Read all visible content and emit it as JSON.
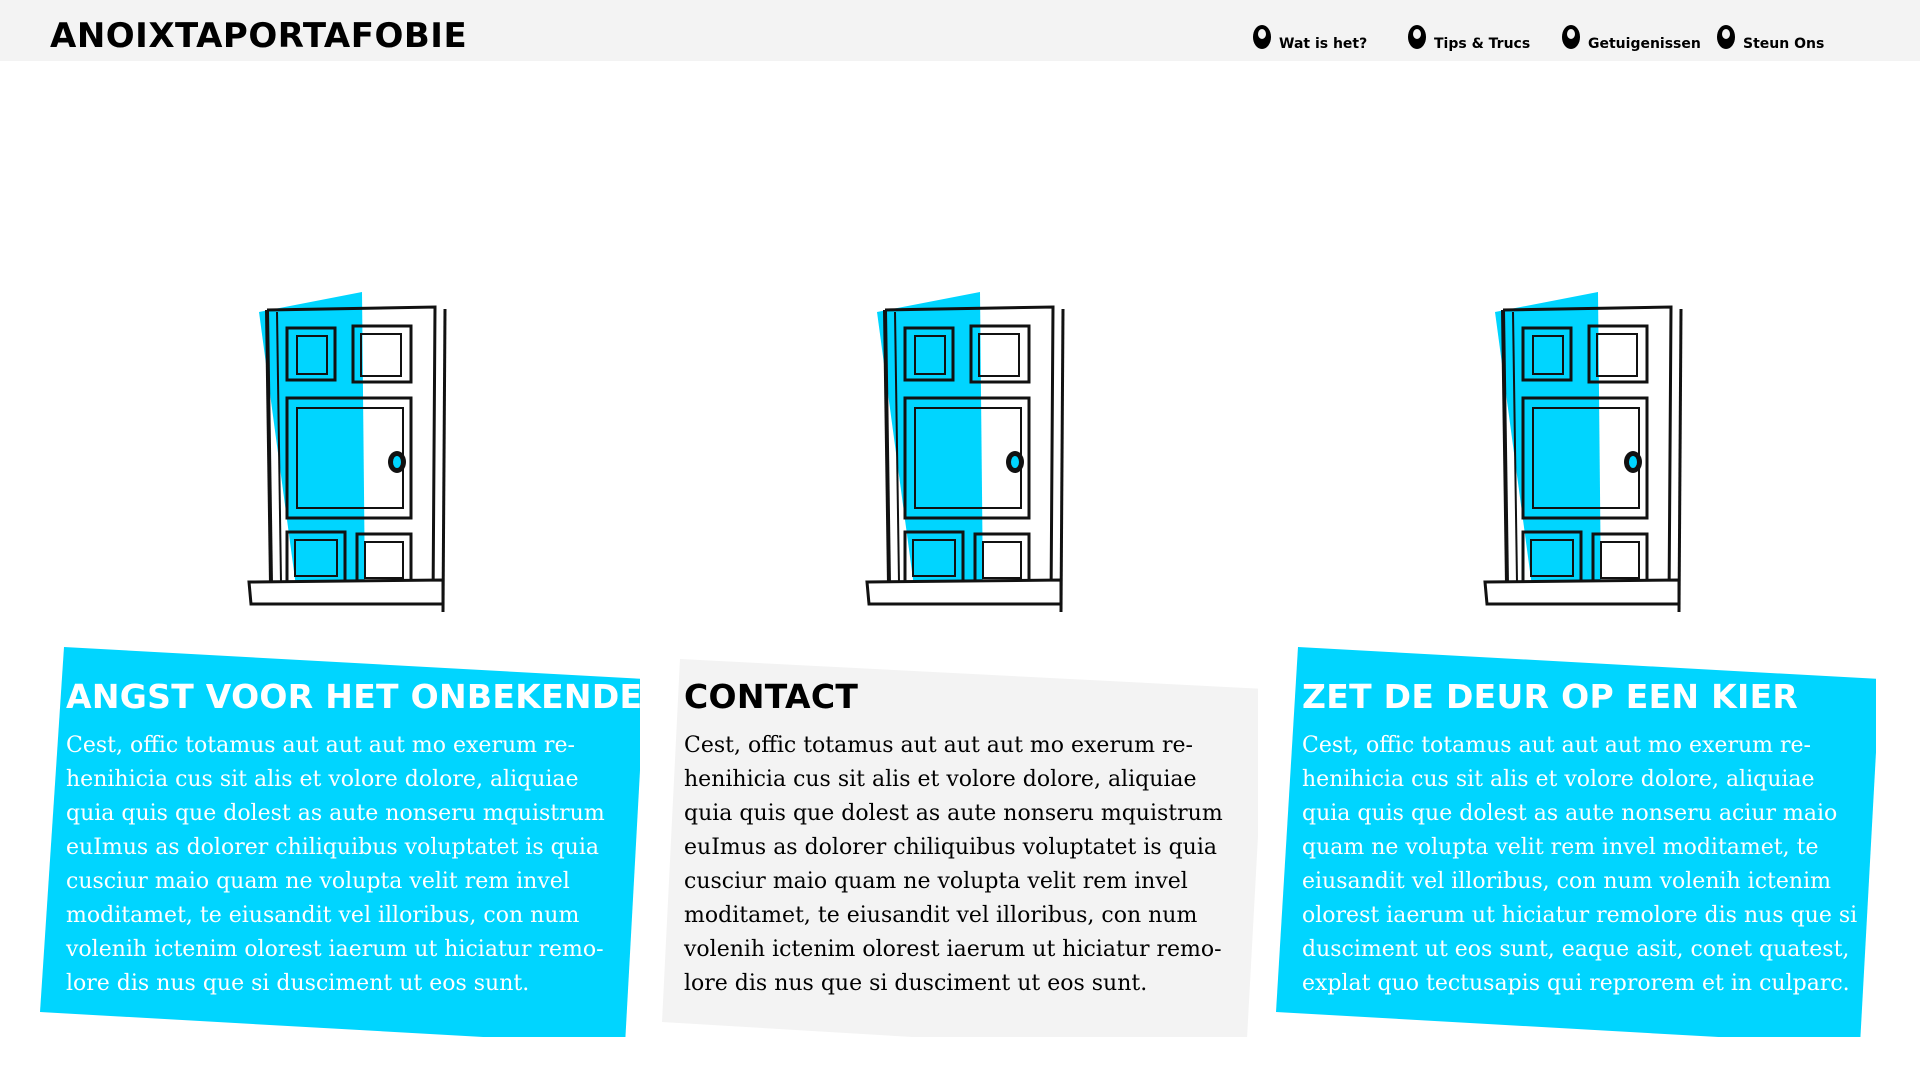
{
  "header": {
    "logo": "ANOIXTAPORTAFOBIE",
    "nav": [
      {
        "label": "Wat is het?",
        "icon": "door-knob-icon"
      },
      {
        "label": "Tips & Trucs",
        "icon": "door-knob-icon"
      },
      {
        "label": "Getuigenissen",
        "icon": "door-knob-icon"
      },
      {
        "label": "Steun Ons",
        "icon": "door-knob-icon"
      }
    ]
  },
  "doors": [
    {
      "icon": "open-door-icon"
    },
    {
      "icon": "open-door-icon"
    },
    {
      "icon": "open-door-icon"
    }
  ],
  "cards": [
    {
      "title": "ANGST VOOR HET ONBEKENDE",
      "text": "Cest, offic totamus aut aut aut mo exerum re-henihicia cus sit alis et volore dolore, aliquiae quia quis que dolest as aute nonseru mquistrum euImus as dolorer chiliquibus voluptatet is quia cusciur maio quam ne volupta velit rem invel moditamet, te eiusandit vel illoribus, con num volenih ictenim olorest iaerum ut hiciatur remo-lore dis nus que si dusciment ut eos sunt.",
      "style": "blue"
    },
    {
      "title": "CONTACT",
      "text": "Cest, offic totamus aut aut aut mo exerum re-henihicia cus sit alis et volore dolore, aliquiae quia quis que dolest as aute nonseru mquistrum euImus as dolorer chiliquibus voluptatet is quia cusciur maio quam ne volupta velit rem invel moditamet, te eiusandit vel illoribus, con num volenih ictenim olorest iaerum ut hiciatur remo-lore dis nus que si dusciment ut eos sunt.",
      "style": "grey"
    },
    {
      "title": "ZET DE DEUR OP EEN KIER",
      "text": "Cest, offic totamus aut aut aut mo exerum re-henihicia cus sit alis et volore dolore, aliquiae quia quis que dolest as aute nonseru aciur maio quam ne volupta velit rem invel moditamet, te eiusandit vel illoribus, con num volenih ictenim olorest iaerum ut hiciatur remolore dis nus que si dusciment ut eos sunt, eaque asit, conet quatest, explat quo tectusapis qui reprorem et in culparc.",
      "style": "blue"
    }
  ],
  "colors": {
    "accent": "#00d5ff",
    "header_bg": "#f3f3f3",
    "card_grey": "#f3f3f3",
    "text": "#000000"
  }
}
